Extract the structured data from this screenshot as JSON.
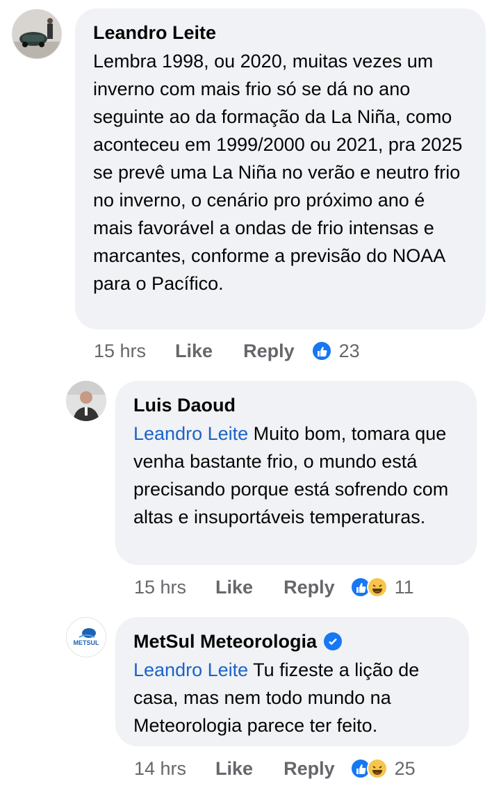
{
  "comments": [
    {
      "author": "Leandro Leite",
      "avatar": "photo-avatar-car",
      "mention": "",
      "text": "Lembra 1998, ou 2020, muitas vezes um inverno com mais frio só se dá no ano seguinte ao da formação da La Niña, como aconteceu em 1999/2000 ou 2021, pra 2025 se prevê uma La Niña no verão e neutro frio no inverno, o cenário pro próximo ano é mais favorável a ondas de frio intensas e marcantes, conforme a previsão do NOAA para o Pacífico.",
      "time": "15 hrs",
      "like_label": "Like",
      "reply_label": "Reply",
      "reactions": [
        "like"
      ],
      "reaction_count": "23"
    },
    {
      "author": "Luis Daoud",
      "avatar": "photo-avatar-man",
      "mention": "Leandro Leite",
      "text": " Muito bom, tomara que venha bastante frio, o mundo está precisando porque está sofrendo com altas e insuportáveis temperaturas.",
      "time": "15 hrs",
      "like_label": "Like",
      "reply_label": "Reply",
      "reactions": [
        "like",
        "haha"
      ],
      "reaction_count": "11"
    },
    {
      "author": "MetSul Meteorologia",
      "avatar": "metsul-logo",
      "avatar_text": "METSUL",
      "verified": true,
      "mention": "Leandro Leite",
      "text": " Tu fizeste a lição de casa, mas nem todo mundo na Meteorologia parece ter feito.",
      "time": "14 hrs",
      "like_label": "Like",
      "reply_label": "Reply",
      "reactions": [
        "like",
        "haha"
      ],
      "reaction_count": "25"
    }
  ],
  "colors": {
    "bubble": "#f0f2f5",
    "mention": "#1b63c8",
    "meta": "#65676b",
    "like": "#1877f2",
    "haha": "#f7c44d"
  }
}
